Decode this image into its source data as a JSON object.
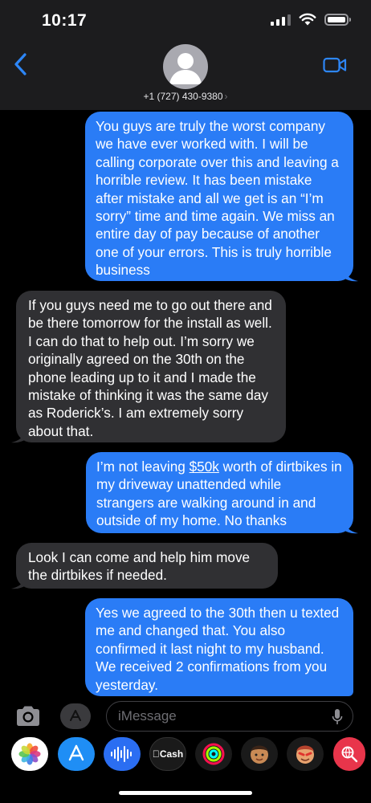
{
  "status_bar": {
    "time": "10:17"
  },
  "header": {
    "contact": "+1 (727) 430-9380",
    "contact_chevron": "›"
  },
  "messages": [
    {
      "direction": "outgoing",
      "text": "You guys are truly the worst company we have ever worked with. I will be calling corporate over this and leaving a horrible review. It has been mistake after mistake and all we get is an “I’m sorry” time and time again. We miss an entire day of pay because of another one of your errors. This is truly horrible business"
    },
    {
      "direction": "incoming",
      "text": "If you guys need me to go out there and be there tomorrow for the install as well. I can do that to help out. I’m sorry we originally agreed on the 30th on the phone leading up to it and I made the mistake of thinking it was the same day as Roderick’s. I am extremely sorry about that."
    },
    {
      "direction": "outgoing",
      "text_before_link": "I’m not leaving ",
      "link_text": "$50k",
      "text_after_link": " worth of dirtbikes in my driveway unattended while strangers are walking around in and outside of my home. No thanks"
    },
    {
      "direction": "incoming",
      "text": "Look I can come and help him move the dirtbikes if needed."
    },
    {
      "direction": "outgoing",
      "text": "Yes we agreed to the 30th then u texted me and changed that. You also confirmed it last night to my husband. We received 2 confirmations from you yesterday."
    }
  ],
  "input_bar": {
    "placeholder": "iMessage"
  },
  "app_drawer": [
    {
      "name": "photos-icon"
    },
    {
      "name": "app-store-icon"
    },
    {
      "name": "audio-message-icon"
    },
    {
      "name": "apple-cash-icon",
      "label": "Cash"
    },
    {
      "name": "activity-icon"
    },
    {
      "name": "memoji-icon"
    },
    {
      "name": "memoji-stickers-icon"
    },
    {
      "name": "search-images-icon"
    }
  ],
  "colors": {
    "outgoing_bubble": "#2a7cf6",
    "incoming_bubble": "#303033",
    "accent": "#2d86f7",
    "header_bg": "#1c1c1e"
  }
}
